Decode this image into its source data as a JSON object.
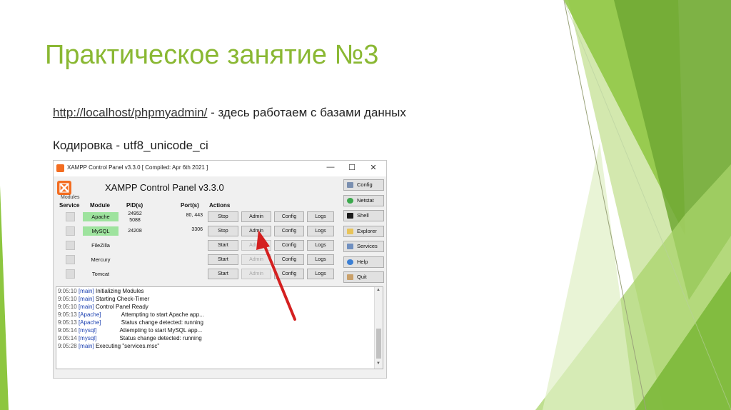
{
  "slide": {
    "title": "Практическое занятие №3",
    "link_text": "http://localhost/phpmyadmin/",
    "link_suffix": " - здесь работаем с базами данных",
    "encoding_text": "Кодировка - utf8_unicode_ci"
  },
  "colors": {
    "title": "#8ab833",
    "accent_green": "#8dc63f",
    "xampp_orange": "#f36d21",
    "running": "#9ee39e",
    "log_tag": "#1a3fb0",
    "arrow": "#d42020"
  },
  "window": {
    "caption": "XAMPP Control Panel v3.3.0   [ Compiled: Apr 6th 2021 ]",
    "app_title": "XAMPP Control Panel v3.3.0",
    "modules_label": "Modules",
    "headers": {
      "service": "Service",
      "module": "Module",
      "pid": "PID(s)",
      "port": "Port(s)",
      "actions": "Actions"
    },
    "rows": [
      {
        "module": "Apache",
        "pid1": "24952",
        "pid2": "5088",
        "port": "80, 443",
        "start": "Stop",
        "admin": "Admin",
        "config": "Config",
        "logs": "Logs"
      },
      {
        "module": "MySQL",
        "pid1": "24208",
        "pid2": "",
        "port": "3306",
        "start": "Stop",
        "admin": "Admin",
        "config": "Config",
        "logs": "Logs"
      },
      {
        "module": "FileZilla",
        "pid1": "",
        "pid2": "",
        "port": "",
        "start": "Start",
        "admin": "Admin",
        "config": "Config",
        "logs": "Logs"
      },
      {
        "module": "Mercury",
        "pid1": "",
        "pid2": "",
        "port": "",
        "start": "Start",
        "admin": "Admin",
        "config": "Config",
        "logs": "Logs"
      },
      {
        "module": "Tomcat",
        "pid1": "",
        "pid2": "",
        "port": "",
        "start": "Start",
        "admin": "Admin",
        "config": "Config",
        "logs": "Logs"
      }
    ],
    "side_buttons": {
      "config": "Config",
      "netstat": "Netstat",
      "shell": "Shell",
      "explorer": "Explorer",
      "services": "Services",
      "help": "Help",
      "quit": "Quit"
    },
    "log": [
      {
        "time": "9:05:10",
        "tag": "[main]",
        "msg": "Initializing Modules"
      },
      {
        "time": "9:05:10",
        "tag": "[main]",
        "msg": "Starting Check-Timer"
      },
      {
        "time": "9:05:10",
        "tag": "[main]",
        "msg": "Control Panel Ready"
      },
      {
        "time": "9:05:13",
        "tag": "[Apache]",
        "msg": "Attempting to start Apache app..."
      },
      {
        "time": "9:05:13",
        "tag": "[Apache]",
        "msg": "Status change detected: running"
      },
      {
        "time": "9:05:14",
        "tag": "[mysql]",
        "msg": "Attempting to start MySQL app..."
      },
      {
        "time": "9:05:14",
        "tag": "[mysql]",
        "msg": "Status change detected: running"
      },
      {
        "time": "9:05:28",
        "tag": "[main]",
        "msg": "Executing \"services.msc\""
      }
    ]
  }
}
